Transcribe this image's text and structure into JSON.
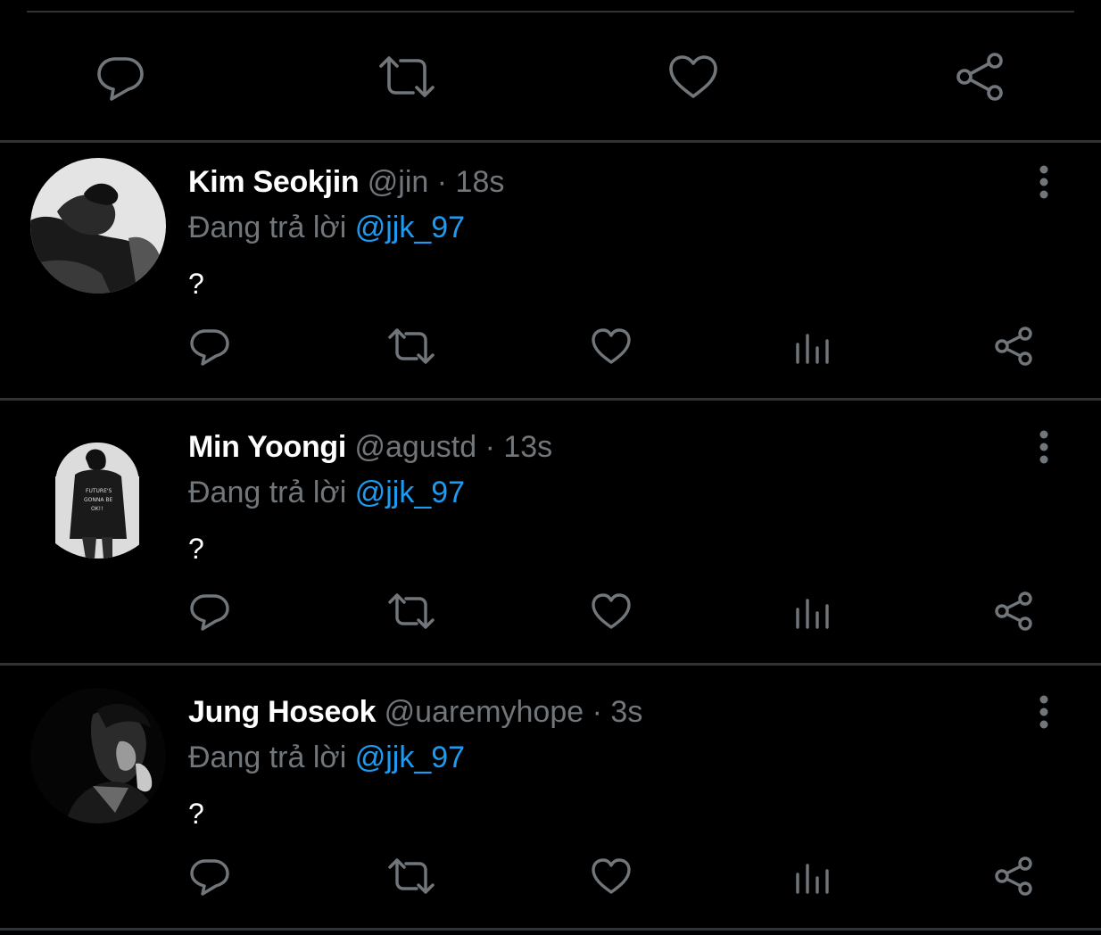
{
  "main_tweet": {
    "actions": [
      {
        "name": "reply",
        "icon": "reply-icon"
      },
      {
        "name": "retweet",
        "icon": "retweet-icon"
      },
      {
        "name": "like",
        "icon": "heart-icon"
      },
      {
        "name": "share",
        "icon": "share-icon"
      }
    ]
  },
  "replies": [
    {
      "display_name": "Kim Seokjin",
      "handle": "@jin",
      "separator": "·",
      "time": "18s",
      "reply_prefix": "Đang trả lời",
      "reply_to": "@jjk_97",
      "text": "?"
    },
    {
      "display_name": "Min Yoongi",
      "handle": "@agustd",
      "separator": "·",
      "time": "13s",
      "reply_prefix": "Đang trả lời",
      "reply_to": "@jjk_97",
      "text": "?"
    },
    {
      "display_name": "Jung Hoseok",
      "handle": "@uaremyhope",
      "separator": "·",
      "time": "3s",
      "reply_prefix": "Đang trả lời",
      "reply_to": "@jjk_97",
      "text": "?"
    }
  ],
  "reply_actions": [
    {
      "name": "reply",
      "icon": "reply-icon"
    },
    {
      "name": "retweet",
      "icon": "retweet-icon"
    },
    {
      "name": "like",
      "icon": "heart-icon"
    },
    {
      "name": "analytics",
      "icon": "bar-chart-icon"
    },
    {
      "name": "share",
      "icon": "share-icon"
    }
  ],
  "colors": {
    "background": "#000000",
    "divider": "#2f3336",
    "text_primary": "#ffffff",
    "text_secondary": "#71767b",
    "accent": "#1d9bf0"
  }
}
